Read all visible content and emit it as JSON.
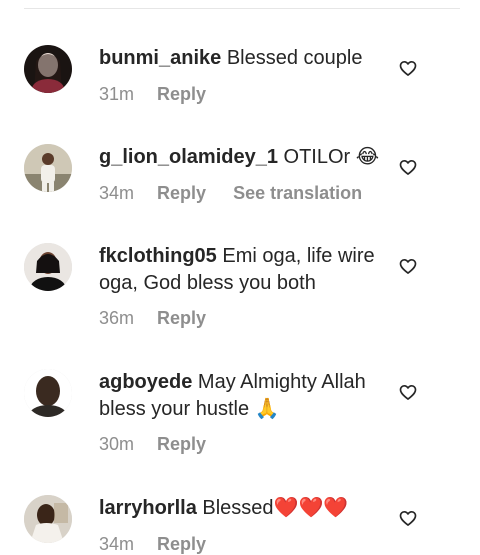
{
  "comments": [
    {
      "username": "bunmi_anike",
      "text": "Blessed couple",
      "time": "31m",
      "reply_label": "Reply",
      "translation_label": null,
      "avatar_icon": "user-avatar-icon"
    },
    {
      "username": "g_lion_olamidey_1",
      "text": "OTILOr 😂",
      "time": "34m",
      "reply_label": "Reply",
      "translation_label": "See translation",
      "avatar_icon": "user-avatar-icon"
    },
    {
      "username": "fkclothing05",
      "text": "Emi oga, life wire oga, God bless you both",
      "time": "36m",
      "reply_label": "Reply",
      "translation_label": null,
      "avatar_icon": "user-avatar-icon"
    },
    {
      "username": "agboyede",
      "text": "May Almighty Allah bless your hustle 🙏",
      "time": "30m",
      "reply_label": "Reply",
      "translation_label": null,
      "avatar_icon": "user-avatar-icon"
    },
    {
      "username": "larryhorlla",
      "text": "Blessed❤️❤️❤️",
      "time": "34m",
      "reply_label": "Reply",
      "translation_label": null,
      "avatar_icon": "user-avatar-icon"
    }
  ],
  "colors": {
    "username": "#262626",
    "meta": "#8e8e8e",
    "divider": "#e6e6e6",
    "heart_outline": "#262626"
  },
  "icons": {
    "like": "heart-outline-icon"
  }
}
